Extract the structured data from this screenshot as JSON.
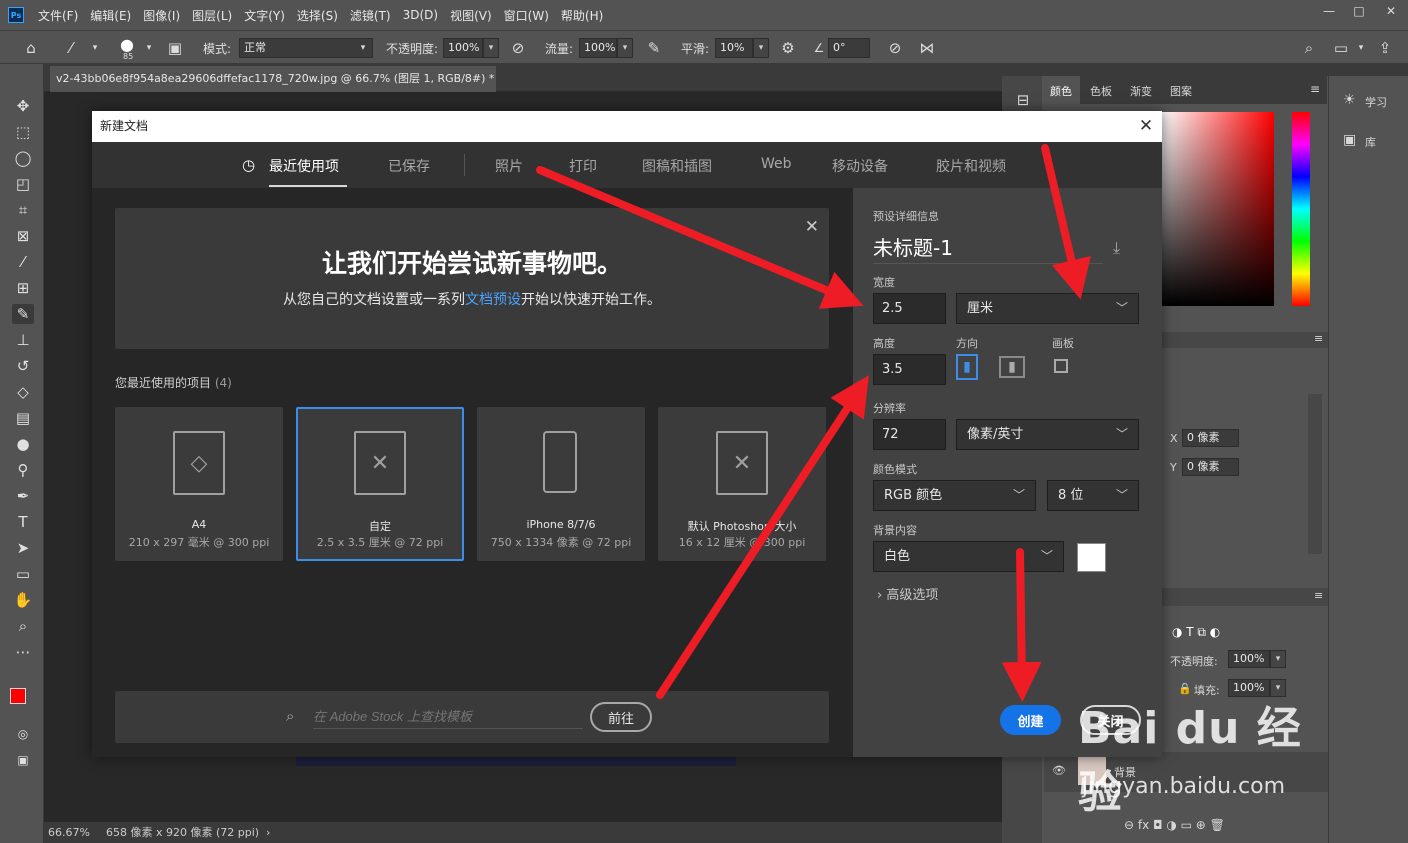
{
  "app": {
    "logo_text": "Ps",
    "menu": [
      "文件(F)",
      "编辑(E)",
      "图像(I)",
      "图层(L)",
      "文字(Y)",
      "选择(S)",
      "滤镜(T)",
      "3D(D)",
      "视图(V)",
      "窗口(W)",
      "帮助(H)"
    ],
    "window_controls": [
      "—",
      "□",
      "✕"
    ]
  },
  "options_bar": {
    "brush_size": "85",
    "mode_label": "模式:",
    "mode_value": "正常",
    "opacity_label": "不透明度:",
    "opacity_value": "100%",
    "flow_label": "流量:",
    "flow_value": "100%",
    "smoothing_label": "平滑:",
    "smoothing_value": "10%",
    "angle_value": "0°"
  },
  "document": {
    "tab_title": "v2-43bb06e8f954a8ea29606dffefac1178_720w.jpg @ 66.7% (图层 1, RGB/8#) *",
    "tab_close": "×",
    "zoom": "66.67%",
    "dimensions": "658 像素 x 920 像素 (72 ppi)",
    "status_arrow": "›"
  },
  "right_panels": {
    "color_tabs": [
      "颜色",
      "色板",
      "渐变",
      "图案"
    ],
    "side_tabs": [
      "学习",
      "库"
    ],
    "x_label": "X",
    "x_value": "0 像素",
    "y_label": "Y",
    "y_value": "0 像素",
    "layer_opacity_label": "不透明度:",
    "layer_opacity_value": "100%",
    "fill_label": "填充:",
    "fill_value": "100%",
    "background_layer": "背景"
  },
  "dialog": {
    "title": "新建文档",
    "tabs": [
      "最近使用项",
      "已保存",
      "照片",
      "打印",
      "图稿和插图",
      "Web",
      "移动设备",
      "胶片和视频"
    ],
    "welcome_title": "让我们开始尝试新事物吧。",
    "welcome_sub_before": "从您自己的文档设置或一系列",
    "welcome_sub_link": "文档预设",
    "welcome_sub_after": "开始以快速开始工作。",
    "recent_title": "您最近使用的项目",
    "recent_count": "(4)",
    "recent_items": [
      {
        "name": "A4",
        "meta": "210 x 297 毫米 @ 300 ppi"
      },
      {
        "name": "自定",
        "meta": "2.5 x 3.5 厘米 @ 72 ppi"
      },
      {
        "name": "iPhone 8/7/6",
        "meta": "750 x 1334 像素 @ 72 ppi"
      },
      {
        "name": "默认 Photoshop 大小",
        "meta": "16 x 12 厘米 @ 300 ppi"
      }
    ],
    "stock_placeholder": "在 Adobe Stock 上查找模板",
    "stock_go": "前往",
    "preset": {
      "section_label": "预设详细信息",
      "doc_name": "未标题-1",
      "width_label": "宽度",
      "width_value": "2.5",
      "width_unit": "厘米",
      "height_label": "高度",
      "height_value": "3.5",
      "orientation_label": "方向",
      "artboard_label": "画板",
      "resolution_label": "分辨率",
      "resolution_value": "72",
      "resolution_unit": "像素/英寸",
      "color_mode_label": "颜色模式",
      "color_mode_value": "RGB 颜色",
      "bit_depth": "8 位",
      "background_label": "背景内容",
      "background_value": "白色",
      "advanced": "高级选项"
    },
    "create_button": "创建",
    "close_button": "关闭"
  },
  "watermark": {
    "line1": "Bai du 经验",
    "line2": "jingyan.baidu.com"
  },
  "colors": {
    "accent_blue": "#1473e6",
    "arrow_red": "#ee1c25",
    "foreground_swatch": "#ff0000",
    "background_swatch": "#ffffff"
  }
}
